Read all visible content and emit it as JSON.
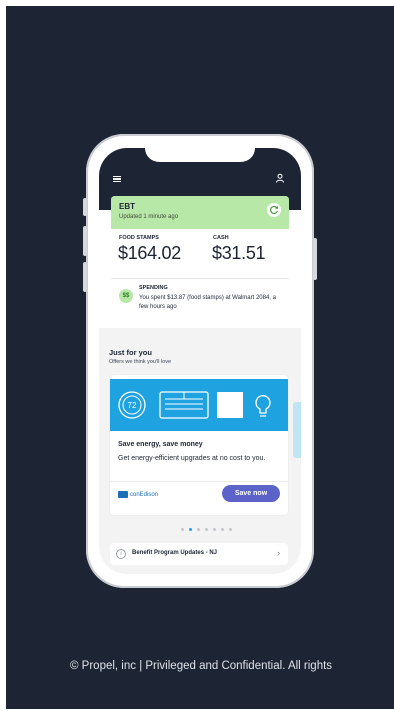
{
  "phone": {
    "ebt": {
      "title": "EBT",
      "updated": "Updated 1 minute ago",
      "food_stamps_label": "FOOD STAMPS",
      "food_stamps_value": "$164.02",
      "cash_label": "CASH",
      "cash_value": "$31.51",
      "spending_badge": "$$",
      "spending_title": "SPENDING",
      "spending_text": "You spent $13.87 (food stamps) at Walmart 2084, a few hours ago"
    },
    "just_for_you": {
      "title": "Just for you",
      "subtitle": "Offers we think you'll love"
    },
    "offer": {
      "thermostat_text": "72",
      "title": "Save energy, save money",
      "description": "Get energy-efficient upgrades at no cost to you.",
      "brand": "conEdison",
      "button_label": "Save now"
    },
    "pagination": {
      "count": 7,
      "active_index": 1
    },
    "benefit_updates": {
      "label": "Benefit Program Updates - NJ"
    }
  },
  "footer": {
    "text": "© Propel, inc | Privileged and Confidential. All rights"
  },
  "colors": {
    "slide_bg": "#1d2433",
    "ebt_green": "#b8e8a8",
    "offer_blue": "#1fa2e0",
    "button_purple": "#5b63c9",
    "brand_blue": "#1d6fb8"
  },
  "icons": [
    "menu-icon",
    "profile-icon",
    "refresh-icon",
    "thermostat-icon",
    "window-ac-icon",
    "lightbulb-icon",
    "coned-logo-icon",
    "info-icon",
    "chevron-right-icon"
  ]
}
